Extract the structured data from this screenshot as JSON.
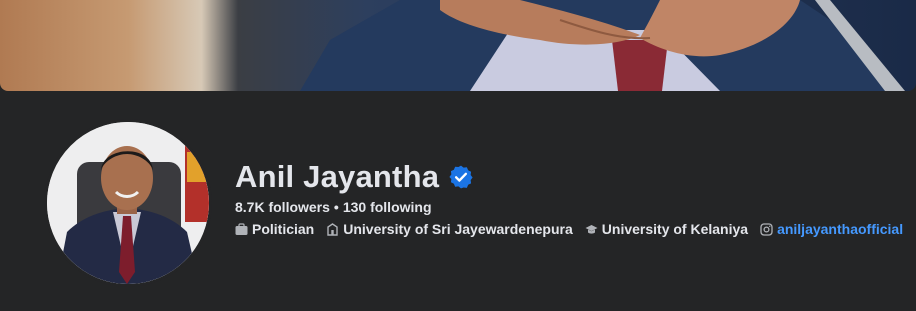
{
  "profile": {
    "name": "Anil Jayantha",
    "verified": true,
    "followers": "8.7K followers",
    "separator": "•",
    "following": "130 following",
    "details": [
      {
        "icon": "briefcase-icon",
        "text": "Politician"
      },
      {
        "icon": "building-icon",
        "text": "University of Sri Jayewardenepura"
      },
      {
        "icon": "graduation-cap-icon",
        "text": "University of Kelaniya"
      },
      {
        "icon": "instagram-icon",
        "text": "aniljayanthaofficial"
      }
    ]
  },
  "colors": {
    "background": "#242526",
    "text": "#e4e6eb",
    "verified_badge": "#1b74e4",
    "link": "#4599ff"
  }
}
